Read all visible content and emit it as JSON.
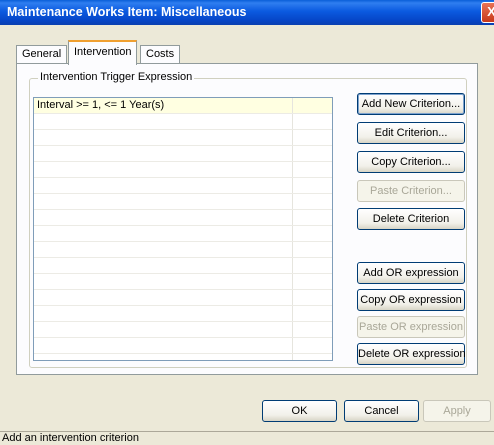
{
  "window": {
    "title": "Maintenance Works Item: Miscellaneous",
    "close_glyph": "X"
  },
  "tabs": [
    {
      "label": "General",
      "active": false
    },
    {
      "label": "Intervention",
      "active": true
    },
    {
      "label": "Costs",
      "active": false
    }
  ],
  "group": {
    "legend": "Intervention Trigger Expression"
  },
  "criteria": [
    {
      "text": "Interval >= 1, <= 1 Year(s)",
      "selected": true
    }
  ],
  "criterion_buttons": [
    {
      "label": "Add New Criterion...",
      "enabled": true,
      "focused": true
    },
    {
      "label": "Edit Criterion...",
      "enabled": true
    },
    {
      "label": "Copy Criterion...",
      "enabled": true
    },
    {
      "label": "Paste Criterion...",
      "enabled": false
    },
    {
      "label": "Delete Criterion",
      "enabled": true
    }
  ],
  "or_buttons": [
    {
      "label": "Add OR expression",
      "enabled": true
    },
    {
      "label": "Copy OR expression",
      "enabled": true
    },
    {
      "label": "Paste OR expression",
      "enabled": false
    },
    {
      "label": "Delete OR expression",
      "enabled": true
    }
  ],
  "dialog_buttons": {
    "ok": "OK",
    "cancel": "Cancel",
    "apply": "Apply",
    "apply_enabled": false
  },
  "status_text": "Add an intervention criterion"
}
